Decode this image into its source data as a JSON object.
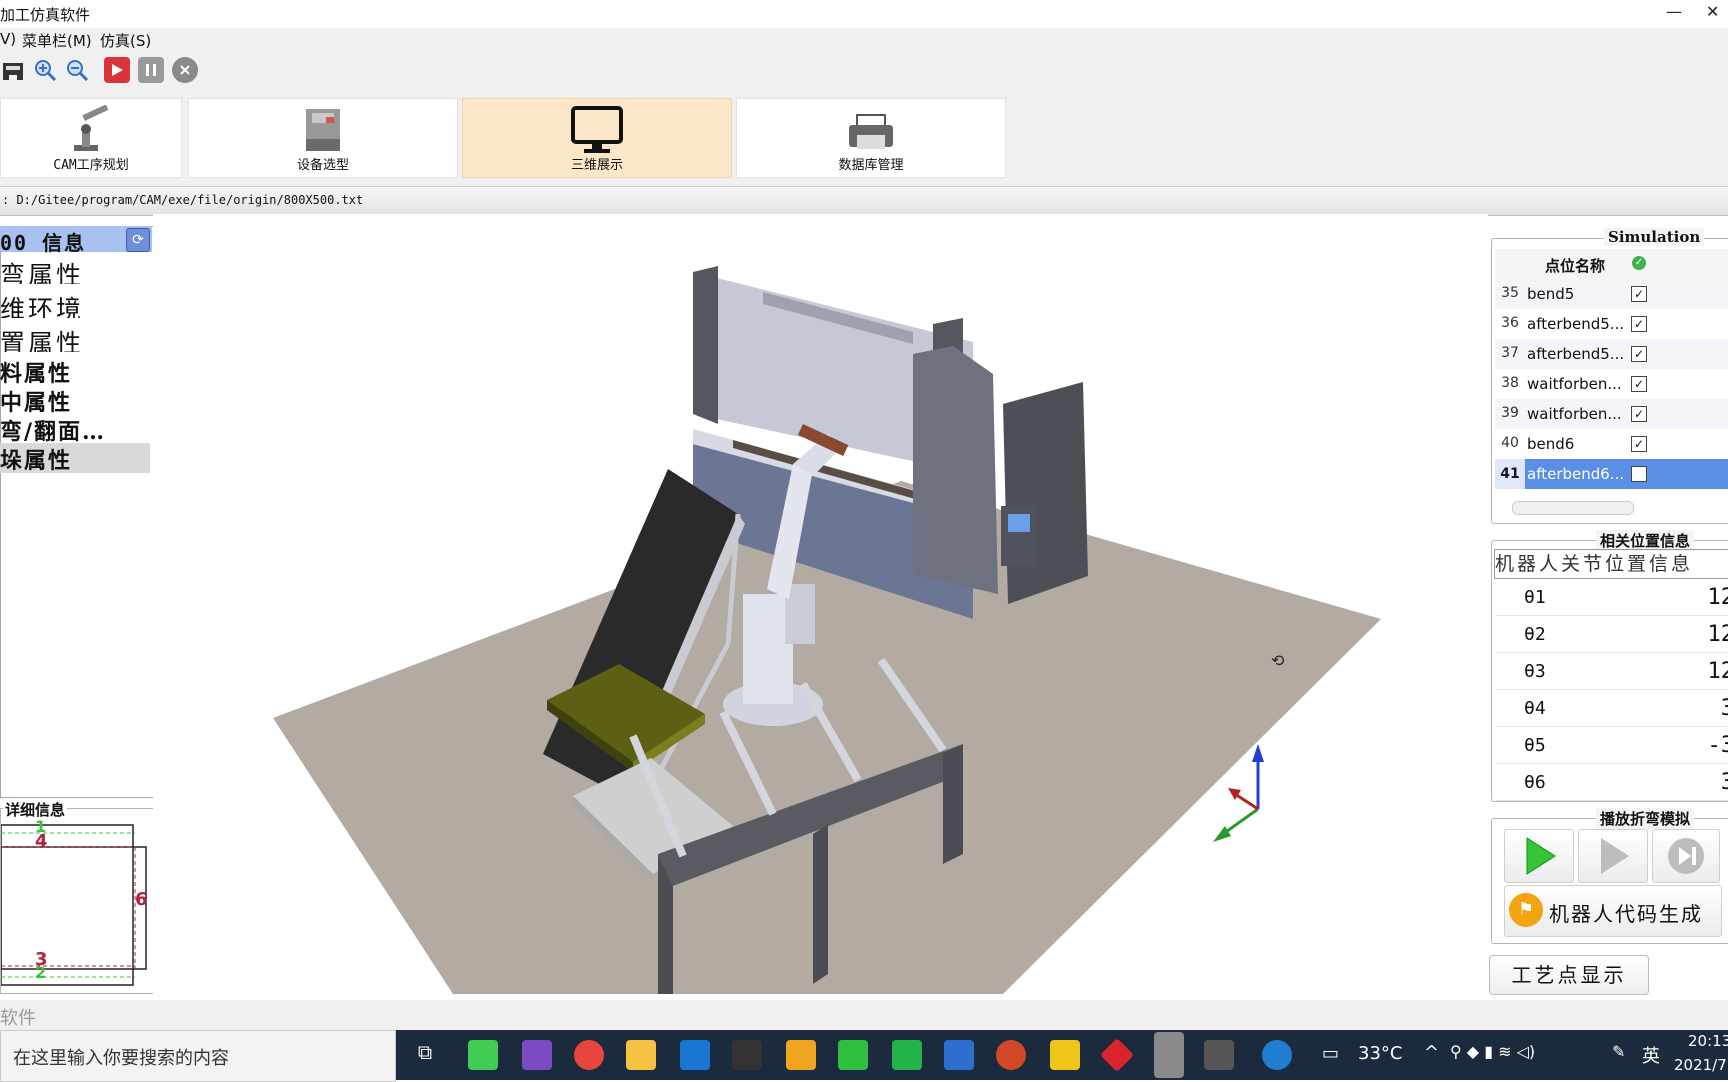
{
  "window": {
    "title": "加工仿真软件",
    "minimize": "—",
    "close": "✕"
  },
  "menubar": {
    "items": [
      "V)",
      "菜单栏(M)",
      "仿真(S)"
    ]
  },
  "modules": [
    {
      "label": "CAM工序规划"
    },
    {
      "label": "设备选型"
    },
    {
      "label": "三维展示"
    },
    {
      "label": "数据库管理"
    }
  ],
  "path": {
    "text": ": D:/Gitee/program/CAM/exe/file/origin/800X500.txt"
  },
  "left_panel": {
    "header": "00 信息",
    "items": [
      "弯属性",
      "维环境",
      "置属性",
      "料属性",
      "中属性",
      "弯/翻面…",
      "垛属性"
    ]
  },
  "detail": {
    "title": "详细信息",
    "markers": [
      "1",
      "4",
      "6",
      "3",
      "2"
    ]
  },
  "simulation": {
    "title": "Simulation",
    "column_name": "点位名称",
    "rows": [
      {
        "num": "35",
        "name": "bend5",
        "checked": "✓"
      },
      {
        "num": "36",
        "name": "afterbend5...",
        "checked": "✓"
      },
      {
        "num": "37",
        "name": "afterbend5...",
        "checked": "✓"
      },
      {
        "num": "38",
        "name": "waitforben...",
        "checked": "✓"
      },
      {
        "num": "39",
        "name": "waitforben...",
        "checked": "✓"
      },
      {
        "num": "40",
        "name": "bend6",
        "checked": "✓"
      },
      {
        "num": "41",
        "name": "afterbend6...",
        "checked": ""
      }
    ]
  },
  "relative_pos": {
    "title": "相关位置信息",
    "subtitle": "机器人关节位置信息",
    "joints": [
      {
        "label": "θ1",
        "value": "12"
      },
      {
        "label": "θ2",
        "value": "12"
      },
      {
        "label": "θ3",
        "value": "12"
      },
      {
        "label": "θ4",
        "value": "3"
      },
      {
        "label": "θ5",
        "value": "-3"
      },
      {
        "label": "θ6",
        "value": "3"
      }
    ]
  },
  "playback": {
    "title": "播放折弯模拟",
    "code_button": "机器人代码生成"
  },
  "process_button": "工艺点显示",
  "status": {
    "text": "软件"
  },
  "taskbar": {
    "search_placeholder": "在这里输入你要搜索的内容",
    "temperature": "33°C",
    "ime": "英",
    "time": "20:13",
    "date": "2021/7"
  },
  "colors": {
    "accent": "#5a8fe6",
    "active_module": "#fde7c9",
    "floor": "#b3aba1",
    "taskbar": "#1b2a3c"
  }
}
